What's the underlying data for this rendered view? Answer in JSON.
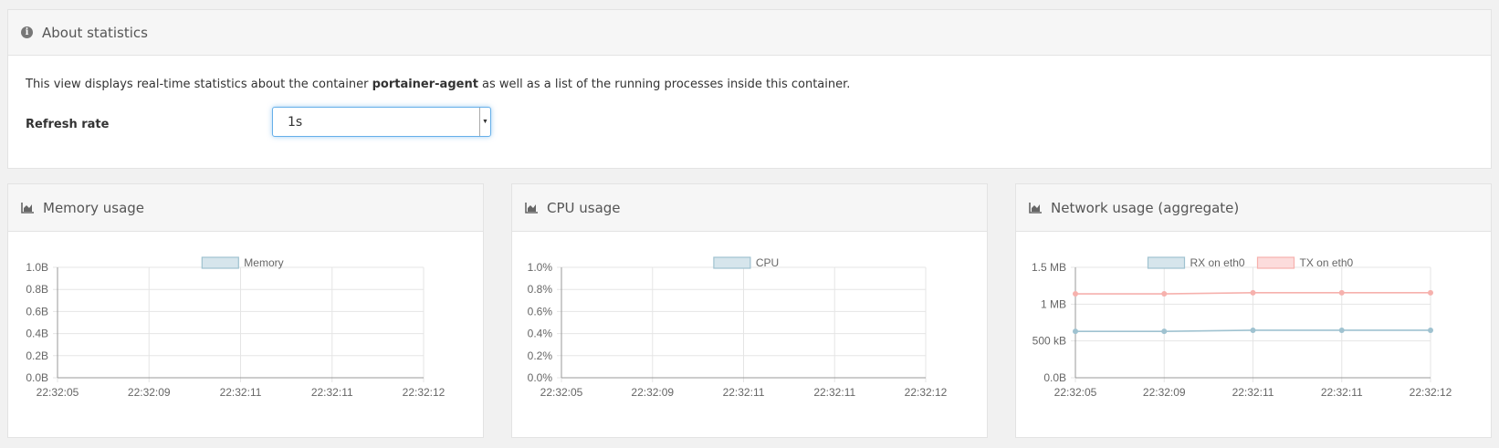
{
  "about": {
    "title": "About statistics",
    "text_before": "This view displays real-time statistics about the container ",
    "container_name": "portainer-agent",
    "text_after": " as well as a list of the running processes inside this container.",
    "refresh_label": "Refresh rate",
    "refresh_value": "1s",
    "icons": {
      "info": "info-circle-icon"
    }
  },
  "widgets": {
    "memory": {
      "title": "Memory usage",
      "icon": "area-chart-icon"
    },
    "cpu": {
      "title": "CPU usage",
      "icon": "area-chart-icon"
    },
    "network": {
      "title": "Network usage (aggregate)",
      "icon": "area-chart-icon"
    }
  },
  "colors": {
    "series_blue_fill": "#d6e5ec",
    "series_blue_line": "#9fc2d0",
    "series_red_fill": "#fcdcdc",
    "series_red_line": "#f6b1ad",
    "grid": "#e5e5e5",
    "axis": "#999999"
  },
  "chart_data": [
    {
      "id": "memory",
      "type": "line",
      "x": [
        "22:32:05",
        "22:32:09",
        "22:32:11",
        "22:32:11",
        "22:32:12"
      ],
      "ylim": [
        0,
        1.0
      ],
      "yticks": [
        0,
        0.2,
        0.4,
        0.6,
        0.8,
        1.0
      ],
      "ytick_labels": [
        "0.0B",
        "0.2B",
        "0.4B",
        "0.6B",
        "0.8B",
        "1.0B"
      ],
      "grid": true,
      "legend_position": "top-center",
      "series": [
        {
          "name": "Memory",
          "values": [],
          "color": "blue"
        }
      ]
    },
    {
      "id": "cpu",
      "type": "line",
      "x": [
        "22:32:05",
        "22:32:09",
        "22:32:11",
        "22:32:11",
        "22:32:12"
      ],
      "ylim": [
        0,
        1.0
      ],
      "yticks": [
        0,
        0.2,
        0.4,
        0.6,
        0.8,
        1.0
      ],
      "ytick_labels": [
        "0.0%",
        "0.2%",
        "0.4%",
        "0.6%",
        "0.8%",
        "1.0%"
      ],
      "grid": true,
      "legend_position": "top-center",
      "series": [
        {
          "name": "CPU",
          "values": [],
          "color": "blue"
        }
      ]
    },
    {
      "id": "network",
      "type": "line",
      "x": [
        "22:32:05",
        "22:32:09",
        "22:32:11",
        "22:32:11",
        "22:32:12"
      ],
      "ylim": [
        0,
        1500000
      ],
      "yticks": [
        0,
        500000,
        1000000,
        1500000
      ],
      "ytick_labels": [
        "0.0B",
        "500 kB",
        "1 MB",
        "1.5 MB"
      ],
      "grid": true,
      "legend_position": "top-center",
      "series": [
        {
          "name": "RX on eth0",
          "values": [
            630000,
            630000,
            645000,
            645000,
            645000
          ],
          "color": "blue"
        },
        {
          "name": "TX on eth0",
          "values": [
            1140000,
            1140000,
            1155000,
            1155000,
            1155000
          ],
          "color": "red"
        }
      ]
    }
  ]
}
